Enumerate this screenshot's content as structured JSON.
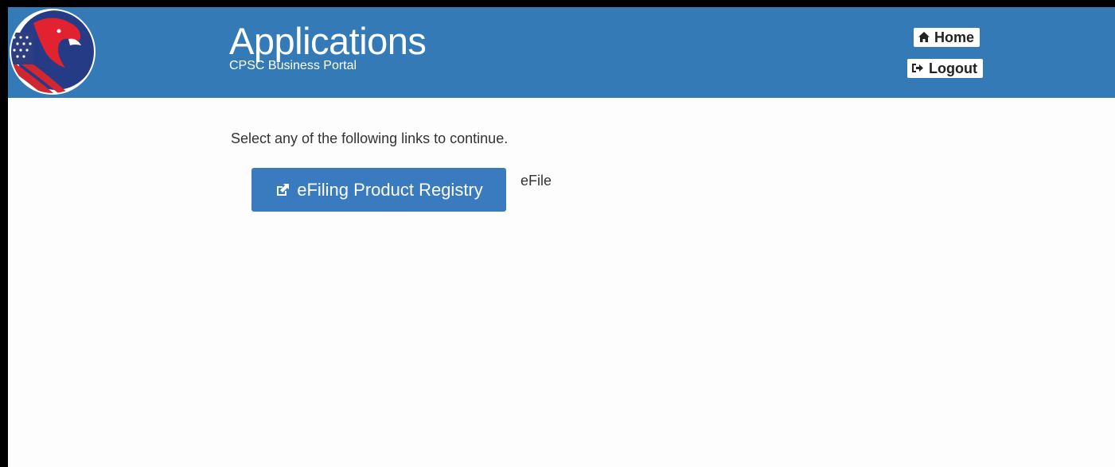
{
  "header": {
    "title": "Applications",
    "subtitle": "CPSC Business Portal",
    "logo_icon": "cpsc-eagle-flag-logo-icon",
    "background_color": "#337ab7",
    "buttons": {
      "home_label": "Home",
      "home_icon": "home-icon",
      "logout_label": "Logout",
      "logout_icon": "logout-icon"
    }
  },
  "main": {
    "intro_text": "Select any of the following links to continue.",
    "applications": [
      {
        "label": "eFiling Product Registry",
        "icon": "external-link-icon",
        "note": "eFile"
      }
    ],
    "button_color": "#3a7bbf"
  }
}
